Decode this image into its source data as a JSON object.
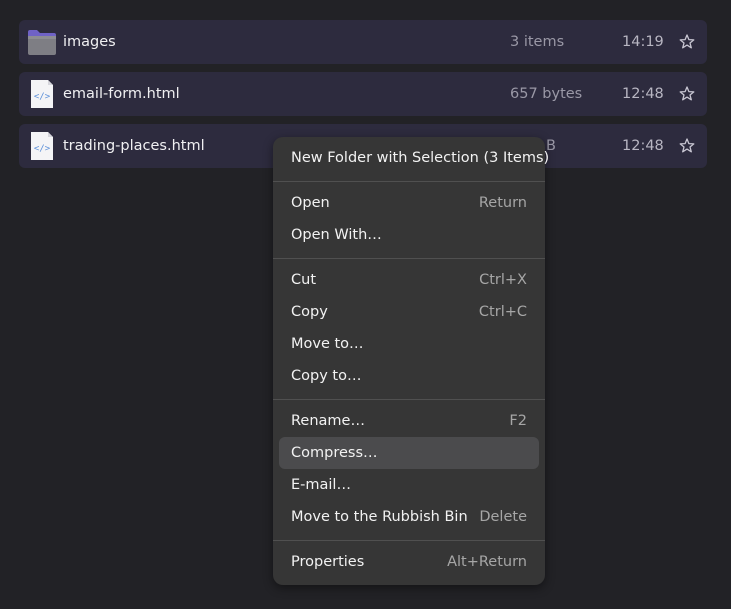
{
  "files": [
    {
      "name": "images",
      "size": "3 items",
      "time": "14:19",
      "icon": "folder-icon",
      "favorite": false
    },
    {
      "name": "email-form.html",
      "size": "657 bytes",
      "time": "12:48",
      "icon": "html-file-icon",
      "favorite": false
    },
    {
      "name": "trading-places.html",
      "size": "B",
      "time": "12:48",
      "icon": "html-file-icon",
      "favorite": false
    }
  ],
  "context_menu": {
    "new_folder_with_selection": {
      "label": "New Folder with Selection (3 Items)",
      "accel": ""
    },
    "open": {
      "label": "Open",
      "accel": "Return"
    },
    "open_with": {
      "label": "Open With…",
      "accel": ""
    },
    "cut": {
      "label": "Cut",
      "accel": "Ctrl+X"
    },
    "copy": {
      "label": "Copy",
      "accel": "Ctrl+C"
    },
    "move_to": {
      "label": "Move to…",
      "accel": ""
    },
    "copy_to": {
      "label": "Copy to…",
      "accel": ""
    },
    "rename": {
      "label": "Rename…",
      "accel": "F2"
    },
    "compress": {
      "label": "Compress…",
      "accel": "",
      "highlighted": true
    },
    "email": {
      "label": "E-mail…",
      "accel": ""
    },
    "move_to_trash": {
      "label": "Move to the Rubbish Bin",
      "accel": "Delete"
    },
    "properties": {
      "label": "Properties",
      "accel": "Alt+Return"
    }
  },
  "colors": {
    "background": "#222226",
    "row": "#2d2b3e",
    "menu": "#363636",
    "menu_hover": "#4b4b4d",
    "folder": "#7a6fd0",
    "html_icon_accent": "#5b8fd9"
  }
}
